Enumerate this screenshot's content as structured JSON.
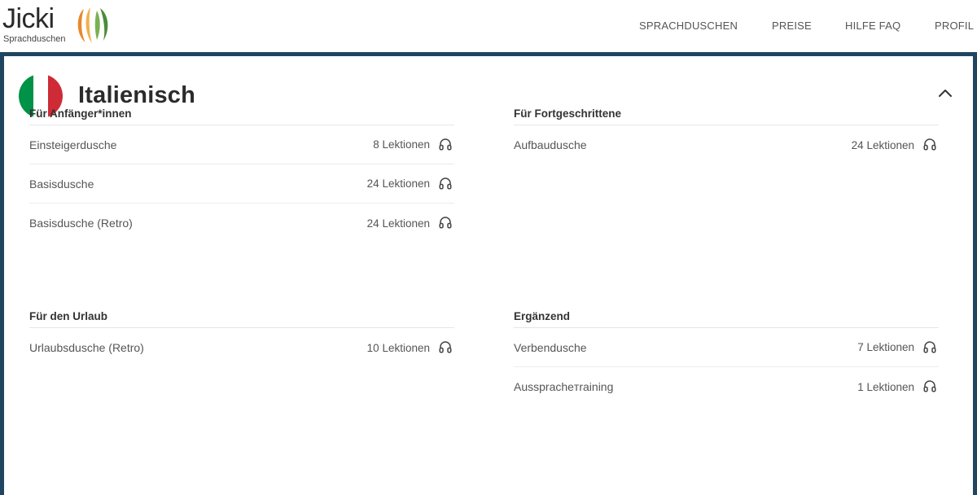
{
  "header": {
    "logo_word": "Jicki",
    "logo_sub": "Sprachduschen",
    "nav": [
      "SPRACHDUSCHEN",
      "PREISE",
      "HILFE FAQ",
      "PROFIL"
    ]
  },
  "language": {
    "title": "Italienisch",
    "flag_colors": [
      "#009246",
      "#ffffff",
      "#ce2b37"
    ]
  },
  "groups": [
    {
      "title": "Für Anfänger*innen",
      "items": [
        {
          "name": "Einsteigerdusche",
          "count": "8 Lektionen"
        },
        {
          "name": "Basisdusche",
          "count": "24 Lektionen"
        },
        {
          "name": "Basisdusche (Retro)",
          "count": "24 Lektionen"
        }
      ]
    },
    {
      "title": "Für Fortgeschrittene",
      "items": [
        {
          "name": "Aufbaudusche",
          "count": "24 Lektionen"
        }
      ]
    },
    {
      "title": "Für den Urlaub",
      "items": [
        {
          "name": "Urlaubsdusche (Retro)",
          "count": "10 Lektionen"
        }
      ]
    },
    {
      "title": "Ergänzend",
      "items": [
        {
          "name": "Verbendusche",
          "count": "7 Lektionen"
        },
        {
          "name": "Ausspracheтraining",
          "count": "1 Lektionen"
        }
      ]
    }
  ],
  "colors": {
    "card_border": "#1f4560",
    "text": "#555555",
    "logo_orange": "#e8892b",
    "logo_green": "#4a8c3a"
  },
  "icons": {
    "item": "headphones-icon",
    "collapse": "chevron-up-icon"
  }
}
